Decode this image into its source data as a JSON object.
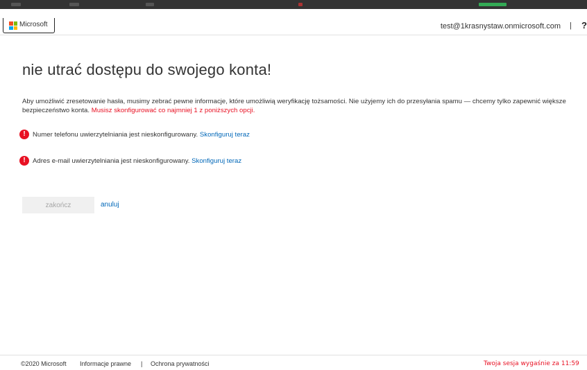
{
  "header": {
    "brand": "Microsoft",
    "user_email": "test@1krasnystaw.onmicrosoft.com",
    "separator": "|",
    "help_label": "?"
  },
  "main": {
    "title": "nie utrać dostępu do swojego konta!",
    "intro": "Aby umożliwić zresetowanie hasła, musimy zebrać pewne informacje, które umożliwią weryfikację tożsamości. Nie użyjemy ich do przesyłania spamu — chcemy tylko zapewnić większe bezpieczeństwo konta.",
    "intro_required": "Musisz skonfigurować co najmniej 1 z poniższych opcji.",
    "options": [
      {
        "text": "Numer telefonu uwierzytelniania jest nieskonfigurowany.",
        "link": "Skonfiguruj teraz"
      },
      {
        "text": "Adres e-mail uwierzytelniania jest nieskonfigurowany.",
        "link": "Skonfiguruj teraz"
      }
    ],
    "finish_label": "zakończ",
    "cancel_label": "anuluj"
  },
  "footer": {
    "copyright": "©2020 Microsoft",
    "legal": "Informacje prawne",
    "separator": "|",
    "privacy": "Ochrona prywatności",
    "session_text": "Twoja sesja wygaśnie za 11:59"
  },
  "colors": {
    "accent_link": "#0067b8",
    "error_red": "#e81123",
    "text": "#333333"
  },
  "icons": {
    "alert": "exclamation-circle-icon",
    "logo": "microsoft-logo-icon"
  }
}
